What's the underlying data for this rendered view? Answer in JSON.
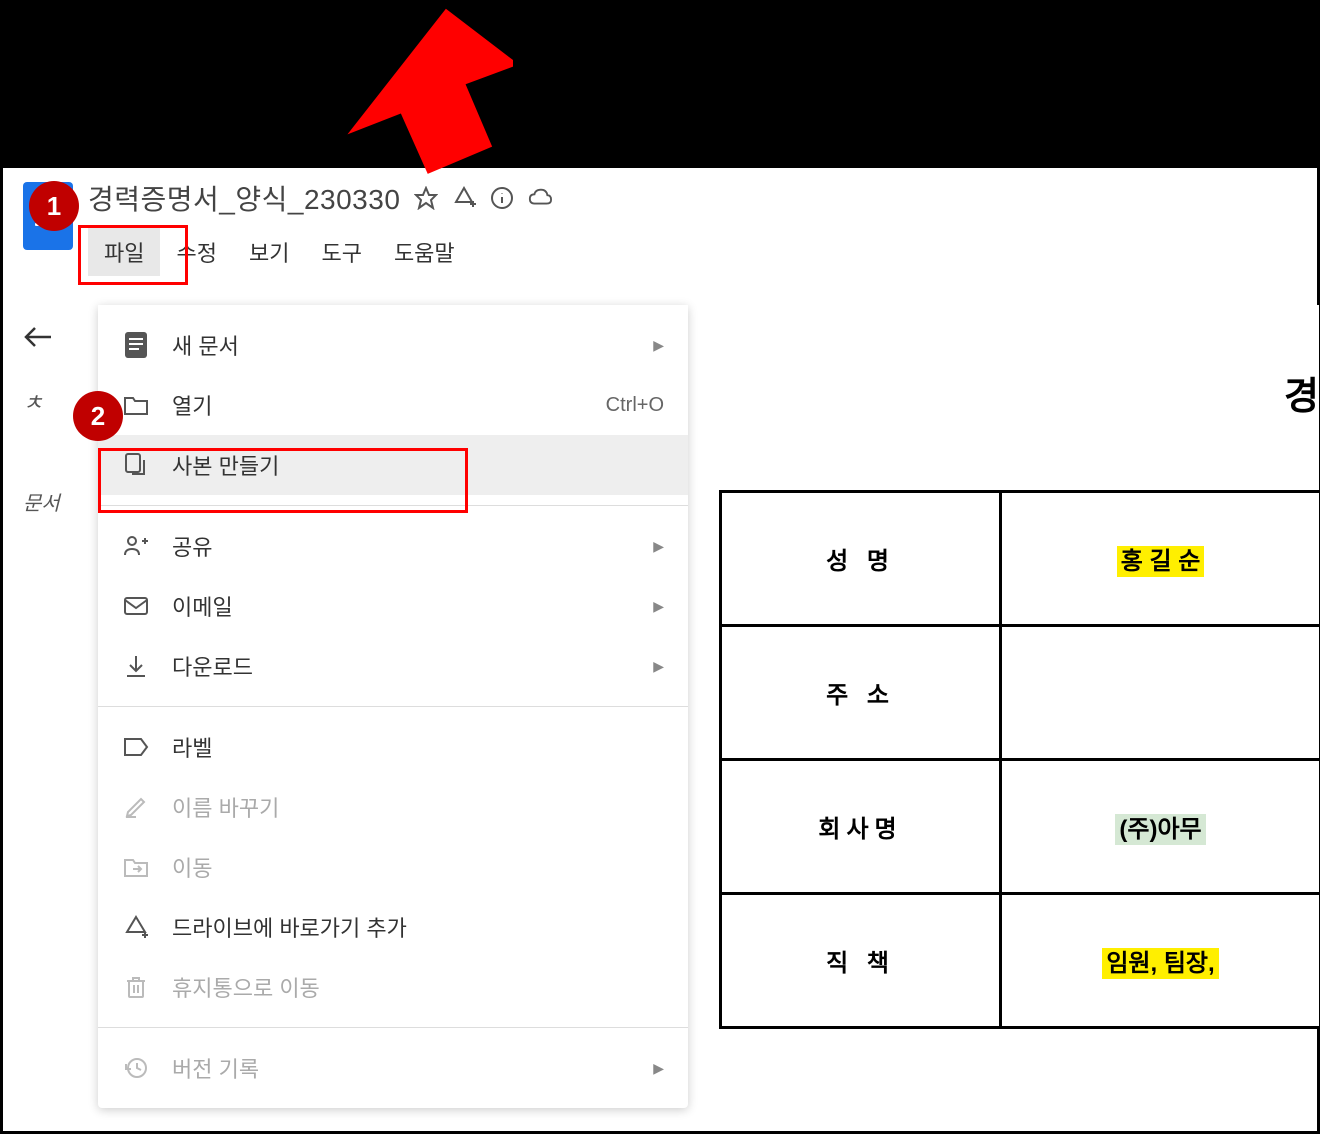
{
  "header": {
    "doc_title": "경력증명서_양식_230330"
  },
  "menu": {
    "file": "파일",
    "edit": "수정",
    "view": "보기",
    "tools": "도구",
    "help": "도움말"
  },
  "sidebar": {
    "back": "←",
    "char1": "ㅊ",
    "char2": "문서"
  },
  "dropdown": {
    "new_doc": "새 문서",
    "open": "열기",
    "open_shortcut": "Ctrl+O",
    "make_copy": "사본 만들기",
    "share": "공유",
    "email": "이메일",
    "download": "다운로드",
    "label": "라벨",
    "rename": "이름 바꾸기",
    "move": "이동",
    "drive_shortcut": "드라이브에 바로가기 추가",
    "trash": "휴지통으로 이동",
    "version_history": "버전 기록"
  },
  "annotations": {
    "badge1": "1",
    "badge2": "2"
  },
  "document": {
    "title": "경",
    "rows": [
      {
        "label": "성 명",
        "value": "홍 길 순",
        "highlight": "yellow"
      },
      {
        "label": "주 소",
        "value": "",
        "highlight": ""
      },
      {
        "label": "회사명",
        "value": "(주)아무",
        "highlight": "green"
      },
      {
        "label": "직 책",
        "value": "임원, 팀장,",
        "highlight": "yellow"
      }
    ]
  }
}
